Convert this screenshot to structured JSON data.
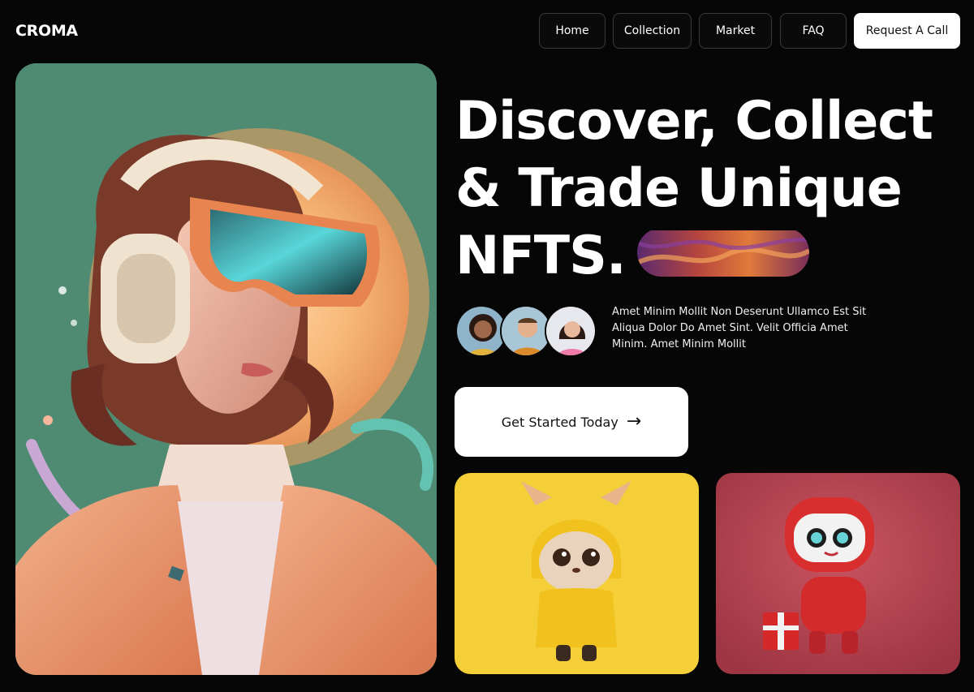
{
  "brand": {
    "logo": "CROMA"
  },
  "nav": {
    "items": [
      {
        "label": "Home"
      },
      {
        "label": "Collection"
      },
      {
        "label": "Market"
      },
      {
        "label": "FAQ"
      }
    ],
    "cta_label": "Request A Call"
  },
  "hero": {
    "headline_line1": "Discover, Collect",
    "headline_line2": "& Trade Unique",
    "headline_line3": "NFTS.",
    "blurb": "Amet Minim Mollit Non Deserunt Ullamco Est Sit Aliqua Dolor Do Amet Sint. Velit Officia Amet Minim. Amet Minim Mollit",
    "cta_label": "Get Started Today",
    "cta_icon": "arrow-right-icon"
  },
  "colors": {
    "background": "#060606",
    "hero_card_bg": "#4f8a72",
    "card_yellow": "#f4cf38",
    "card_red": "#b4424e",
    "button_light": "#ffffff"
  },
  "images": {
    "hero": "girl-with-vr-goggles-and-headphones",
    "pill": "abstract-lava-texture",
    "avatars": [
      "avatar-woman-curly-hair",
      "avatar-man-smiling",
      "avatar-woman-pink-top"
    ],
    "card_1": "kitten-in-yellow-raincoat",
    "card_2": "red-robot-with-gift-box"
  }
}
